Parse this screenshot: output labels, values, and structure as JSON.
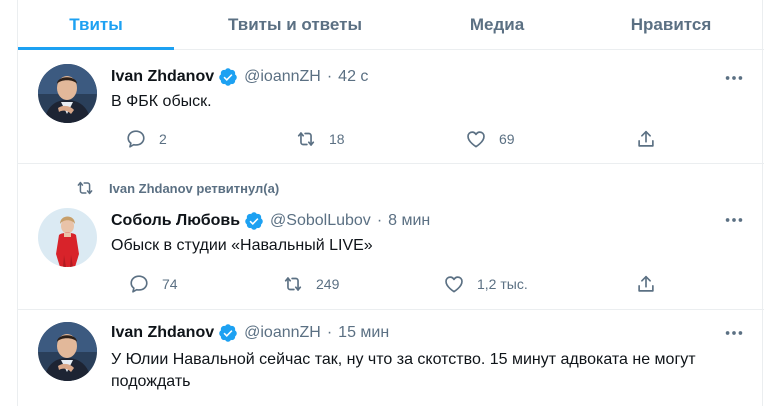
{
  "tabs": [
    {
      "label": "Твиты",
      "active": true
    },
    {
      "label": "Твиты и ответы",
      "active": false
    },
    {
      "label": "Медиа",
      "active": false
    },
    {
      "label": "Нравится",
      "active": false
    }
  ],
  "colors": {
    "accent": "#1da1f2",
    "secondary_text": "#5b7083",
    "border": "#ebeef0",
    "verified": "#1da1f2"
  },
  "tweets": [
    {
      "name": "Ivan Zhdanov",
      "handle": "@ioannZH",
      "sep": "·",
      "time": "42 с",
      "text": "В ФБК обыск.",
      "replies": "2",
      "retweets": "18",
      "likes": "69"
    },
    {
      "retweet_label": "Ivan Zhdanov ретвитнул(а)",
      "name": "Соболь Любовь",
      "handle": "@SobolLubov",
      "sep": "·",
      "time": "8 мин",
      "text": "Обыск в студии «Навальный LIVE»",
      "replies": "74",
      "retweets": "249",
      "likes": "1,2 тыс."
    },
    {
      "name": "Ivan Zhdanov",
      "handle": "@ioannZH",
      "sep": "·",
      "time": "15 мин",
      "text": "У Юлии Навальной сейчас так, ну что за скотство. 15 минут адвоката не могут подождать"
    }
  ],
  "icons": {
    "verified": "verified-badge-icon",
    "more": "more-dots-icon",
    "reply": "reply-bubble-icon",
    "retweet": "retweet-arrows-icon",
    "like": "heart-icon",
    "share": "share-upload-icon"
  }
}
